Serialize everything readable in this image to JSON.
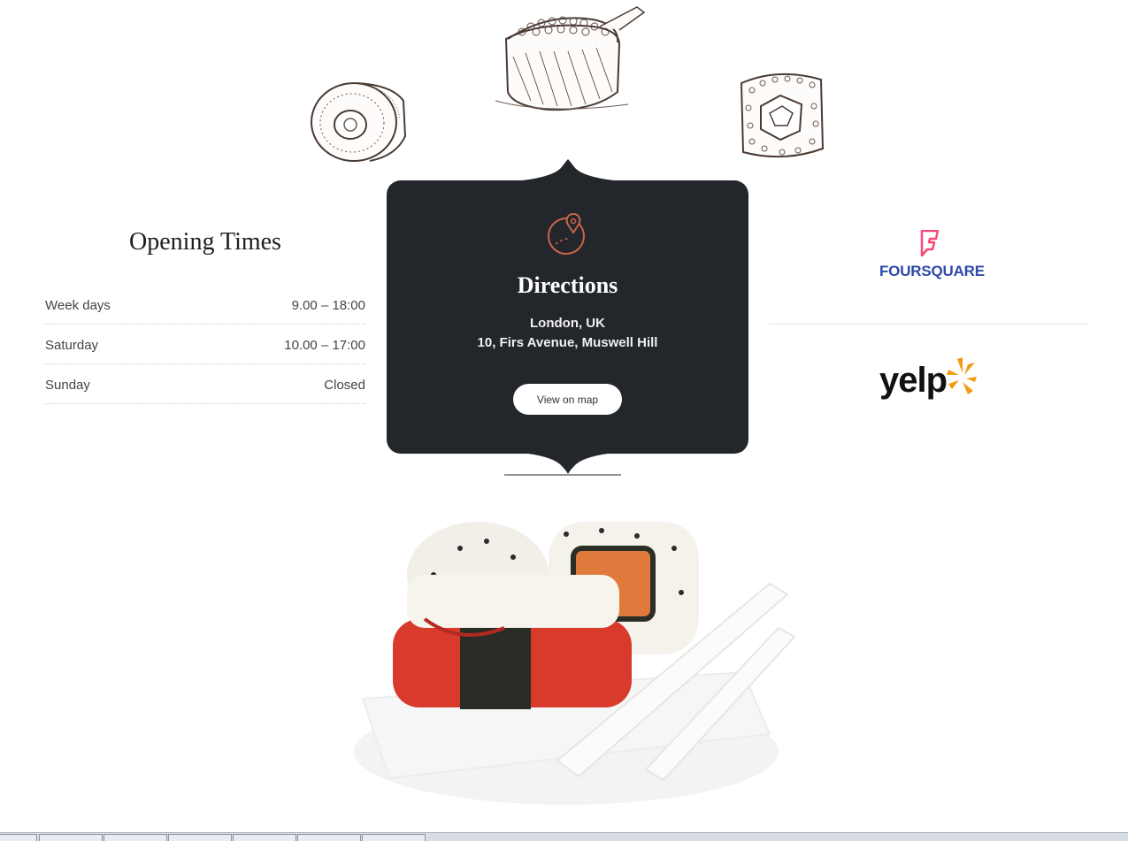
{
  "opening_times": {
    "title": "Opening Times",
    "rows": [
      {
        "day": "Week days",
        "hours": "9.00 – 18:00"
      },
      {
        "day": "Saturday",
        "hours": "10.00 – 17:00"
      },
      {
        "day": "Sunday",
        "hours": "Closed"
      }
    ]
  },
  "directions": {
    "title": "Directions",
    "city": "London, UK",
    "address": "10, Firs Avenue, Muswell Hill",
    "button_label": "View on map",
    "icon": "map-pin-icon",
    "accent_color": "#c8664a",
    "card_color": "#23262b"
  },
  "logos": {
    "foursquare": {
      "label": "FOURSQUARE",
      "icon": "foursquare-icon",
      "color": "#2d49a8",
      "icon_color": "#f94877"
    },
    "yelp": {
      "label": "yelp",
      "icon": "yelp-burst-icon",
      "burst_color": "#f39c12"
    }
  }
}
